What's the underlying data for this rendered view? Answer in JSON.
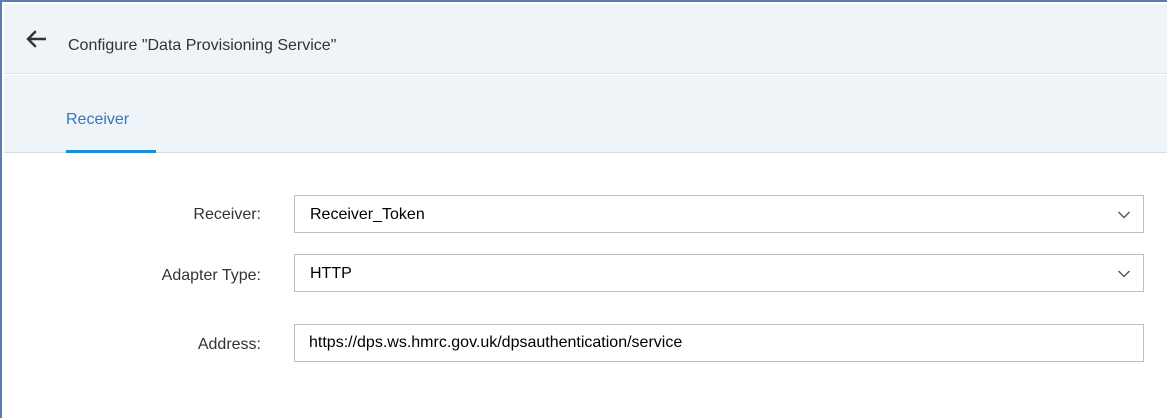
{
  "header": {
    "back_icon": "arrow-left-icon",
    "title": "Configure \"Data Provisioning Service\""
  },
  "tabs": [
    {
      "label": "Receiver",
      "selected": true
    }
  ],
  "form": {
    "receiver": {
      "label": "Receiver:",
      "value": "Receiver_Token",
      "icon": "chevron-down-icon"
    },
    "adapter_type": {
      "label": "Adapter Type:",
      "value": "HTTP",
      "icon": "chevron-down-icon"
    },
    "address": {
      "label": "Address:",
      "value": "https://dps.ws.hmrc.gov.uk/dpsauthentication/service"
    }
  },
  "colors": {
    "accent": "#1b8dd6",
    "tab_text": "#3079b8",
    "header_bg": "#eff4f9"
  }
}
